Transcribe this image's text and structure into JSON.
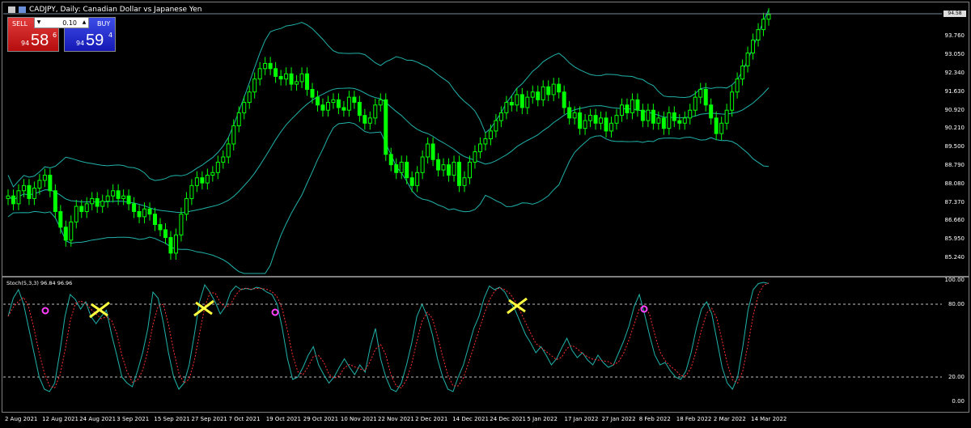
{
  "chart": {
    "symbol_title": "CADJPY, Daily:  Canadian Dollar vs Japanese Yen",
    "last_price_tag": "94.58"
  },
  "trade_panel": {
    "sell_label": "SELL",
    "buy_label": "BUY",
    "lot": "0.10",
    "sell_price": {
      "small": "94",
      "big": "58",
      "sup": "6"
    },
    "buy_price": {
      "small": "94",
      "big": "59",
      "sup": "4"
    }
  },
  "price_axis": [
    "94.580",
    "93.760",
    "93.050",
    "92.340",
    "91.630",
    "90.920",
    "90.210",
    "89.500",
    "88.790",
    "88.080",
    "87.370",
    "86.660",
    "85.950",
    "85.240"
  ],
  "stoch": {
    "label": "Stoch(5,3,3) 96.84 96.96",
    "axis": [
      "100.00",
      "80.00",
      "20.00",
      "0.00"
    ]
  },
  "time_axis": [
    "2 Aug 2021",
    "12 Aug 2021",
    "24 Aug 2021",
    "3 Sep 2021",
    "15 Sep 2021",
    "27 Sep 2021",
    "7 Oct 2021",
    "19 Oct 2021",
    "29 Oct 2021",
    "10 Nov 2021",
    "22 Nov 2021",
    "2 Dec 2021",
    "14 Dec 2021",
    "24 Dec 2021",
    "5 Jan 2022",
    "17 Jan 2022",
    "27 Jan 2022",
    "8 Feb 2022",
    "18 Feb 2022",
    "2 Mar 2022",
    "14 Mar 2022"
  ],
  "colors": {
    "bull": "#00ff00",
    "bands": "#20b2aa",
    "stoch_main": "#20b2aa",
    "stoch_signal": "#ff3030",
    "marker_x": "#ffff40",
    "marker_o": "#ff40ff"
  },
  "chart_data": {
    "type": "candlestick",
    "closes": [
      87.6,
      87.3,
      87.8,
      88.0,
      87.5,
      87.9,
      88.2,
      88.4,
      87.8,
      87.0,
      86.4,
      85.9,
      86.6,
      87.2,
      87.0,
      87.3,
      87.5,
      87.2,
      87.4,
      87.6,
      87.8,
      87.5,
      87.6,
      87.3,
      87.0,
      86.8,
      87.1,
      86.9,
      86.5,
      86.3,
      86.0,
      85.4,
      86.1,
      86.9,
      87.5,
      88.0,
      88.3,
      88.1,
      88.4,
      88.5,
      88.9,
      89.1,
      89.6,
      90.3,
      90.8,
      91.2,
      91.6,
      92.1,
      92.5,
      92.7,
      92.5,
      92.2,
      92.1,
      92.3,
      91.9,
      92.0,
      92.3,
      91.7,
      91.4,
      91.1,
      90.9,
      91.2,
      91.3,
      91.0,
      90.9,
      91.4,
      91.2,
      90.7,
      90.4,
      90.6,
      91.1,
      91.3,
      89.2,
      88.8,
      88.5,
      88.9,
      88.3,
      88.0,
      88.5,
      89.1,
      89.6,
      89.0,
      88.6,
      88.8,
      88.4,
      88.9,
      88.0,
      88.3,
      88.9,
      89.3,
      89.6,
      89.8,
      90.1,
      90.5,
      90.8,
      91.2,
      91.1,
      91.5,
      91.0,
      91.4,
      91.6,
      91.3,
      91.8,
      91.5,
      91.9,
      91.6,
      91.0,
      90.6,
      90.8,
      90.2,
      90.5,
      90.7,
      90.4,
      90.6,
      90.1,
      90.4,
      90.7,
      91.1,
      90.8,
      91.3,
      90.9,
      90.5,
      90.9,
      90.4,
      90.6,
      90.2,
      90.8,
      90.5,
      90.4,
      90.6,
      90.9,
      91.4,
      91.7,
      91.1,
      90.6,
      90.0,
      90.4,
      90.9,
      91.6,
      92.1,
      92.6,
      93.1,
      93.6,
      94.0,
      94.4,
      94.58
    ],
    "stoch_main": [
      70,
      85,
      92,
      80,
      60,
      40,
      20,
      10,
      8,
      15,
      40,
      70,
      88,
      84,
      76,
      82,
      70,
      64,
      70,
      75,
      55,
      38,
      20,
      15,
      12,
      25,
      40,
      60,
      90,
      85,
      65,
      40,
      20,
      10,
      15,
      30,
      55,
      82,
      96,
      90,
      82,
      72,
      78,
      90,
      95,
      92,
      93,
      92,
      94,
      93,
      90,
      88,
      80,
      60,
      35,
      18,
      20,
      28,
      38,
      45,
      30,
      22,
      15,
      20,
      28,
      35,
      28,
      22,
      30,
      24,
      45,
      60,
      35,
      20,
      10,
      8,
      15,
      30,
      48,
      70,
      80,
      70,
      55,
      35,
      20,
      10,
      8,
      20,
      30,
      45,
      60,
      70,
      85,
      95,
      92,
      94,
      90,
      82,
      75,
      65,
      55,
      48,
      40,
      45,
      38,
      30,
      35,
      44,
      52,
      42,
      36,
      40,
      34,
      30,
      38,
      32,
      28,
      30,
      40,
      50,
      62,
      78,
      88,
      72,
      54,
      38,
      30,
      32,
      25,
      20,
      18,
      25,
      40,
      60,
      76,
      82,
      72,
      50,
      28,
      15,
      10,
      20,
      45,
      75,
      92,
      97,
      98,
      97
    ]
  }
}
